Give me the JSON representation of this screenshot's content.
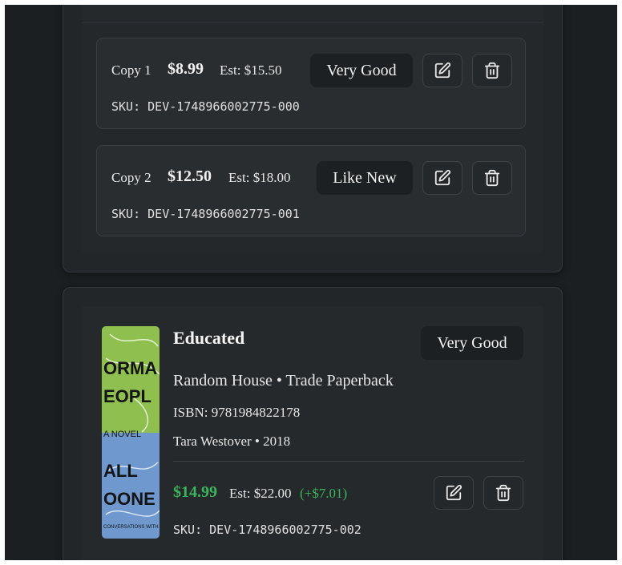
{
  "copies": [
    {
      "label": "Copy 1",
      "price": "$8.99",
      "est": "Est: $15.50",
      "condition": "Very Good",
      "sku": "SKU: DEV-1748966002775-000"
    },
    {
      "label": "Copy 2",
      "price": "$12.50",
      "est": "Est: $18.00",
      "condition": "Like New",
      "sku": "SKU: DEV-1748966002775-001"
    }
  ],
  "book": {
    "title": "Educated",
    "condition": "Very Good",
    "publisher_format": "Random House • Trade Paperback",
    "isbn": "ISBN: 9781984822178",
    "author_year": "Tara Westover • 2018",
    "price": "$14.99",
    "est": "Est: $22.00",
    "gain": "(+$7.01)",
    "sku": "SKU: DEV-1748966002775-002",
    "cover_text": {
      "top_lines": [
        "ORMA",
        "EOPL"
      ],
      "novel": "A NOVEL",
      "bottom_lines": [
        "ALL",
        "OONE"
      ],
      "blurb": "CONVERSATIONS WITH"
    },
    "cover_colors": {
      "top": "#8ebf4f",
      "bottom": "#6f98cf"
    }
  },
  "icons": {
    "edit": "edit-icon",
    "delete": "trash-icon"
  }
}
